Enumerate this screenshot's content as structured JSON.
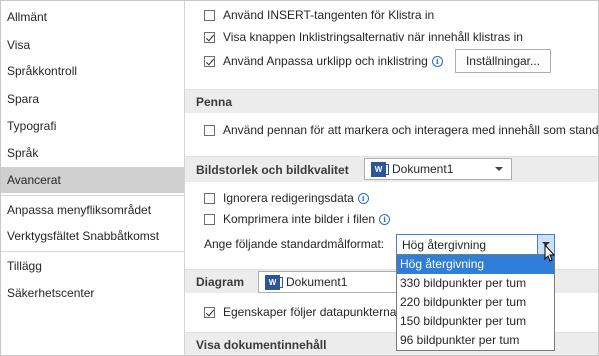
{
  "sidebar": {
    "items": [
      {
        "label": "Allmänt"
      },
      {
        "label": "Visa"
      },
      {
        "label": "Språkkontroll"
      },
      {
        "label": "Spara"
      },
      {
        "label": "Typografi"
      },
      {
        "label": "Språk"
      },
      {
        "label": "Avancerat"
      },
      {
        "label": "Anpassa menyfliksområdet"
      },
      {
        "label": "Verktygsfältet Snabbåtkomst"
      },
      {
        "label": "Tillägg"
      },
      {
        "label": "Säkerhetscenter"
      }
    ],
    "active_index": 6
  },
  "editing": {
    "insert_key": {
      "label": "Använd INSERT-tangenten för Klistra in",
      "checked": false
    },
    "paste_options": {
      "label": "Visa knappen Inklistringsalternativ när innehåll klistras in",
      "checked": true
    },
    "smart_cut": {
      "label": "Använd Anpassa urklipp och inklistring",
      "checked": true
    },
    "settings_button": "Inställningar..."
  },
  "pen": {
    "title": "Penna",
    "use_pen": {
      "label": "Använd pennan för att markera och interagera med innehåll som standard",
      "checked": false
    }
  },
  "image_size": {
    "title": "Bildstorlek och bildkvalitet",
    "document": "Dokument1",
    "discard_edit": {
      "label": "Ignorera redigeringsdata",
      "checked": false
    },
    "no_compress": {
      "label": "Komprimera inte bilder i filen",
      "checked": false
    },
    "default_resolution_label": "Ange följande standardmålformat:",
    "selected_resolution": "Hög återgivning",
    "options": [
      {
        "label": "Hög återgivning",
        "selected": true
      },
      {
        "label": "330 bildpunkter per tum",
        "selected": false
      },
      {
        "label": "220 bildpunkter per tum",
        "selected": false
      },
      {
        "label": "150 bildpunkter per tum",
        "selected": false
      },
      {
        "label": "96 bildpunkter per tum",
        "selected": false
      }
    ]
  },
  "chart": {
    "title": "Diagram",
    "document": "Dokument1",
    "properties_follow": {
      "label": "Egenskaper följer datapunkterna",
      "checked": true
    }
  },
  "display": {
    "title": "Visa dokumentinnehåll"
  },
  "colors": {
    "active_sidebar": "#cfcfcf",
    "selected_option": "#2f7ed8",
    "word_icon": "#2b579a"
  },
  "icons": {
    "info": "info-icon",
    "word_document": "word-document-icon",
    "cursor": "mouse-cursor-icon"
  }
}
